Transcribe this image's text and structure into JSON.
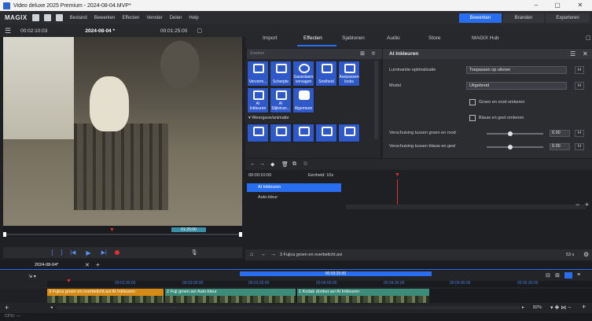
{
  "titlebar": {
    "title": "Video deluxe 2025 Premium - 2024-08-04.MVP*",
    "minimize": "–",
    "maximize": "▢",
    "close": "✕"
  },
  "menubar": {
    "logo": "MAGIX",
    "items": [
      "Bestand",
      "Bewerken",
      "Effecten",
      "Venster",
      "Delen",
      "Help"
    ],
    "modes": [
      "Bewerken",
      "Branden",
      "Exporteren"
    ]
  },
  "preview": {
    "timecode_left": "00:02:10:03",
    "project": "2024-08-04 *",
    "timecode_right": "00:01:25:00",
    "marker_label": "01:25:00"
  },
  "right_tabs": [
    "Import",
    "Effecten",
    "Sjablonen",
    "Audio",
    "Store",
    "MAGIX Hub"
  ],
  "effects": {
    "search_placeholder": "Zoeken",
    "cells": [
      {
        "label": "Vervorm..."
      },
      {
        "label": "Scherpte"
      },
      {
        "label": "Gausslaars vervagen"
      },
      {
        "label": "Snelheid"
      },
      {
        "label": "Aanpassen looks"
      },
      {
        "label": "AI Inkleuren"
      },
      {
        "label": "AI Stijletran..."
      },
      {
        "label": "Algemeen"
      }
    ],
    "section": "Weergave/animatie"
  },
  "ai_panel": {
    "title": "AI Inkleuren",
    "lum_label": "Luminantie-optimalisatie",
    "lum_value": "Toepassen op uitvoer",
    "model_label": "Model",
    "model_value": "Uitgebreid",
    "chk1": "Groen en rood omkeren",
    "chk2": "Blauw en geel omkeren",
    "shift1_label": "Verschuiving tussen groen en rood",
    "shift1_value": "0.00",
    "shift2_label": "Verschuiving tussen blauw en geel",
    "shift2_value": "0.00"
  },
  "keyframes": {
    "time": "00:00:10:00",
    "unit": "Eenheid: 10s",
    "rows": [
      {
        "label": "AI Inkleuren"
      },
      {
        "label": "Auto-kleur"
      }
    ]
  },
  "nav": {
    "clip_name": "3 Fujica groen en overbelicht.avi",
    "speed": "53 s"
  },
  "project_tab": {
    "name": "2024-08-04*",
    "close": "✕",
    "add": "+"
  },
  "timeline": {
    "ruler_marks": [
      "00:01:30:00",
      "00:03:00:00",
      "00:03:30:00",
      "00:04:00:00",
      "00:04:30:00",
      "00:05:00:00",
      "00:05:30:00"
    ],
    "playhead_label": "00:03:25:00",
    "clips": [
      {
        "label": "3 Fujica groen en overbelicht.avi  AI Inkleuren"
      },
      {
        "label": "2 Fuji groen.avi  Auto-kleur"
      },
      {
        "label": "1 Kodak donker.avi  AI Inkleuren"
      }
    ],
    "zoom": "82%"
  },
  "status": {
    "text": "CPU: —"
  }
}
